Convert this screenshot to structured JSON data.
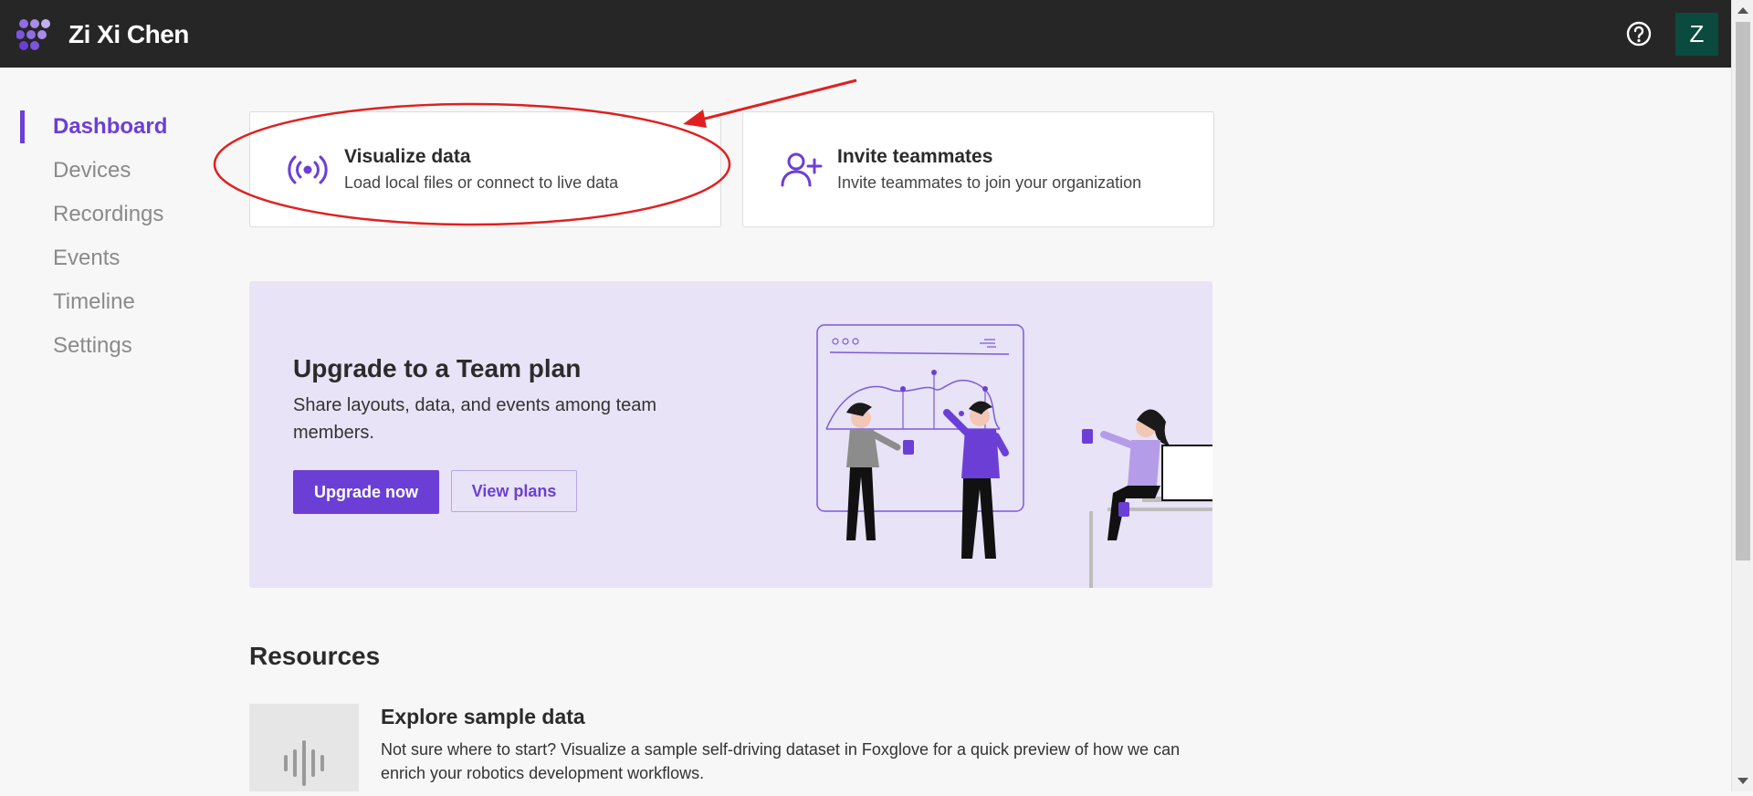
{
  "header": {
    "org_name": "Zi Xi Chen",
    "avatar_initial": "Z",
    "help_icon": "question-circle-icon",
    "logo_icon": "foxglove-logo-icon"
  },
  "sidebar": {
    "items": [
      {
        "label": "Dashboard",
        "active": true
      },
      {
        "label": "Devices"
      },
      {
        "label": "Recordings"
      },
      {
        "label": "Events"
      },
      {
        "label": "Timeline"
      },
      {
        "label": "Settings"
      }
    ]
  },
  "cards": {
    "visualize": {
      "title": "Visualize data",
      "subtitle": "Load local files or connect to live data",
      "icon": "broadcast-icon"
    },
    "invite": {
      "title": "Invite teammates",
      "subtitle": "Invite teammates to join your organization",
      "icon": "add-user-icon"
    }
  },
  "banner": {
    "title": "Upgrade to a Team plan",
    "description": "Share layouts, data, and events among team members.",
    "primary_label": "Upgrade now",
    "secondary_label": "View plans"
  },
  "resources": {
    "title": "Resources",
    "items": [
      {
        "title": "Explore sample data",
        "description": "Not sure where to start? Visualize a sample self-driving dataset in Foxglove for a quick preview of how we can enrich your robotics development workflows.",
        "icon": "waveform-icon"
      }
    ]
  },
  "colors": {
    "accent": "#6b3fd6",
    "topbar": "#262626",
    "avatar": "#0b4a3e",
    "banner_bg": "#e8e3f6",
    "annotation": "#e02020"
  }
}
